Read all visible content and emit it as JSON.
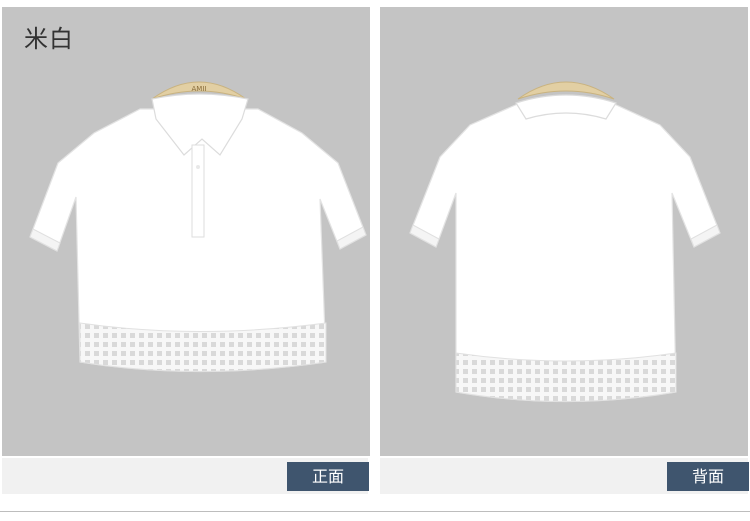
{
  "color_label": "米白",
  "hanger_brand": "AMII",
  "views": {
    "front_label": "正面",
    "back_label": "背面"
  },
  "colors": {
    "panel_background": "#c4c4c4",
    "badge_background": "#3f556e",
    "garment": "#ffffff"
  }
}
